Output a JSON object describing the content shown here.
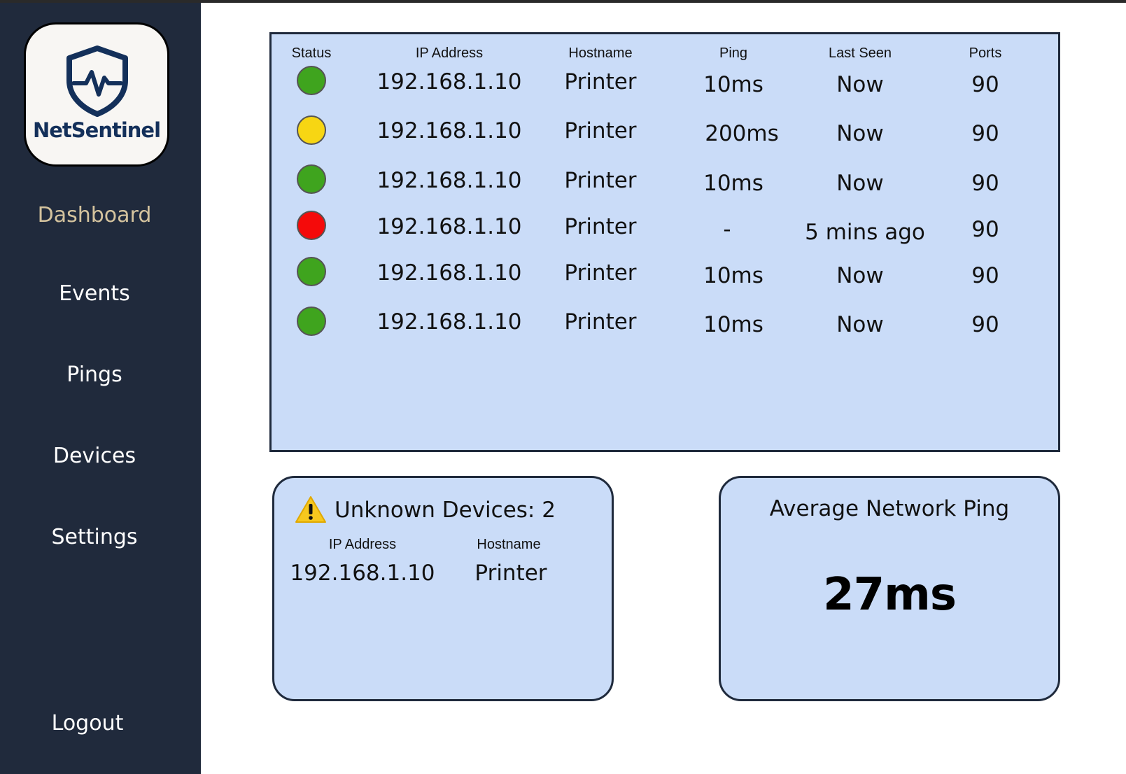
{
  "app": {
    "logo_text": "NetSentinel"
  },
  "nav": {
    "items": [
      {
        "label": "Dashboard",
        "active": true
      },
      {
        "label": "Events",
        "active": false
      },
      {
        "label": "Pings",
        "active": false
      },
      {
        "label": "Devices",
        "active": false
      },
      {
        "label": "Settings",
        "active": false
      }
    ],
    "logout_label": "Logout"
  },
  "devices_table": {
    "headers": [
      "Status",
      "IP Address",
      "Hostname",
      "Ping",
      "Last Seen",
      "Ports"
    ],
    "rows": [
      {
        "status": "online",
        "ip": "192.168.1.10",
        "hostname": "Printer",
        "ping": "10ms",
        "last_seen": "Now",
        "ports": "90"
      },
      {
        "status": "warning",
        "ip": "192.168.1.10",
        "hostname": "Printer",
        "ping": "200ms",
        "last_seen": "Now",
        "ports": "90"
      },
      {
        "status": "online",
        "ip": "192.168.1.10",
        "hostname": "Printer",
        "ping": "10ms",
        "last_seen": "Now",
        "ports": "90"
      },
      {
        "status": "offline",
        "ip": "192.168.1.10",
        "hostname": "Printer",
        "ping": "-",
        "last_seen": "5 mins ago",
        "ports": "90"
      },
      {
        "status": "online",
        "ip": "192.168.1.10",
        "hostname": "Printer",
        "ping": "10ms",
        "last_seen": "Now",
        "ports": "90"
      },
      {
        "status": "online",
        "ip": "192.168.1.10",
        "hostname": "Printer",
        "ping": "10ms",
        "last_seen": "Now",
        "ports": "90"
      }
    ],
    "status_colors": {
      "online": "#3fa41e",
      "warning": "#f7d613",
      "offline": "#f50a0a"
    }
  },
  "unknown_devices": {
    "title": "Unknown Devices: 2",
    "icon": "warning-icon",
    "headers": [
      "IP Address",
      "Hostname"
    ],
    "rows": [
      {
        "ip": "192.168.1.10",
        "hostname": "Printer"
      }
    ]
  },
  "average_ping": {
    "title": "Average Network Ping",
    "value": "27ms"
  },
  "colors": {
    "sidebar": "#202a3c",
    "panel": "#cadcf8",
    "active_nav": "#d4c39e",
    "logo_text": "#14305a"
  }
}
